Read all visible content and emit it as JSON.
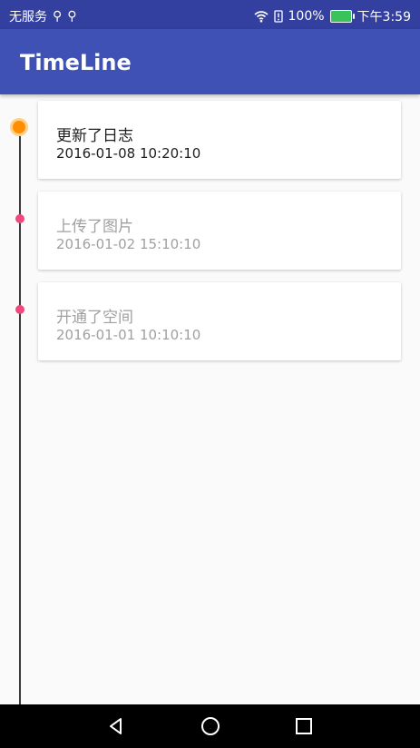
{
  "status_bar": {
    "carrier": "无服务",
    "usb_icons": [
      "usb-icon",
      "usb-icon"
    ],
    "battery_percent": "100%",
    "time": "下午3:59"
  },
  "app_bar": {
    "title": "TimeLine",
    "background": "#3f51b5"
  },
  "timeline": {
    "items": [
      {
        "title": "更新了日志",
        "time": "2016-01-08 10:20:10",
        "state": "active",
        "dot_color": "#ff8f00"
      },
      {
        "title": "上传了图片",
        "time": "2016-01-02 15:10:10",
        "state": "normal",
        "dot_color": "#f0487d"
      },
      {
        "title": "开通了空间",
        "time": "2016-01-01 10:10:10",
        "state": "normal",
        "dot_color": "#f0487d"
      }
    ]
  },
  "nav_bar": {
    "buttons": [
      "back-icon",
      "home-icon",
      "recent-apps-icon"
    ]
  }
}
